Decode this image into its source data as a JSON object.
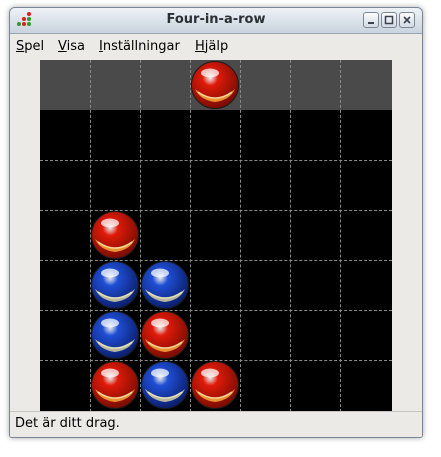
{
  "window": {
    "title": "Four-in-a-row",
    "buttons": [
      "minimize-icon",
      "maximize-icon",
      "close-icon"
    ]
  },
  "menu": [
    {
      "mnemonic": "S",
      "rest": "pel"
    },
    {
      "mnemonic": "V",
      "rest": "isa"
    },
    {
      "mnemonic": "I",
      "rest": "nställningar"
    },
    {
      "mnemonic": "H",
      "rest": "jälp"
    }
  ],
  "board": {
    "columns": 7,
    "rows": 6,
    "drop_row_piece": {
      "column": 4,
      "player": "red"
    },
    "pieces": [
      {
        "row": 3,
        "column": 2,
        "player": "red"
      },
      {
        "row": 4,
        "column": 2,
        "player": "blue"
      },
      {
        "row": 4,
        "column": 3,
        "player": "blue"
      },
      {
        "row": 5,
        "column": 2,
        "player": "blue"
      },
      {
        "row": 5,
        "column": 3,
        "player": "red"
      },
      {
        "row": 6,
        "column": 2,
        "player": "red"
      },
      {
        "row": 6,
        "column": 3,
        "player": "blue"
      },
      {
        "row": 6,
        "column": 4,
        "player": "red"
      }
    ],
    "colors": {
      "red": "#e01a0a",
      "blue": "#1f4fd6",
      "drop_row": "#4a4a4a",
      "board": "#000000"
    }
  },
  "status": {
    "text": "Det är ditt drag."
  }
}
